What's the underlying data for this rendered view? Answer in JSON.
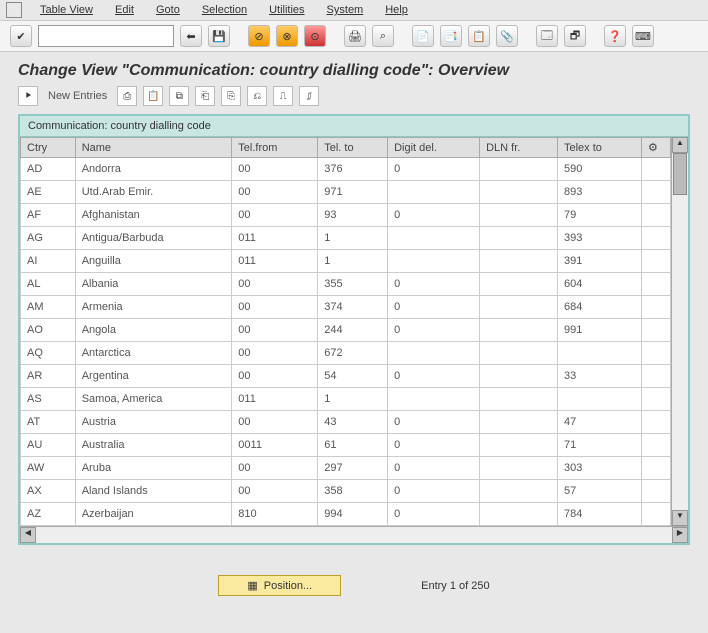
{
  "menu": {
    "items": [
      "Table View",
      "Edit",
      "Goto",
      "Selection",
      "Utilities",
      "System",
      "Help"
    ]
  },
  "toolbar": {
    "icons": [
      "✔",
      "⬅",
      "💾",
      "",
      "⊘",
      "⊗",
      "⊙",
      "",
      "🖨",
      "⌕",
      "",
      "📄",
      "📑",
      "📋",
      "📎",
      "",
      "🗔",
      "🗗",
      "",
      "❓",
      "⌨"
    ]
  },
  "title": "Change View \"Communication: country dialling code\": Overview",
  "appbar": {
    "new_entries": "New Entries",
    "icons": [
      "⎙",
      "📋",
      "⧉",
      "⎗",
      "⎘",
      "⎌",
      "⎍",
      "⎎"
    ]
  },
  "frame_title": "Communication: country dialling code",
  "cols": [
    "Ctry",
    "Name",
    "Tel.from",
    "Tel. to",
    "Digit del.",
    "DLN fr.",
    "Telex to"
  ],
  "rows": [
    {
      "c": "AD",
      "n": "Andorra",
      "tf": "00",
      "tt": "376",
      "dd": "0",
      "df": "",
      "tx": "590"
    },
    {
      "c": "AE",
      "n": "Utd.Arab Emir.",
      "tf": "00",
      "tt": "971",
      "dd": "",
      "df": "",
      "tx": "893"
    },
    {
      "c": "AF",
      "n": "Afghanistan",
      "tf": "00",
      "tt": "93",
      "dd": "0",
      "df": "",
      "tx": "79"
    },
    {
      "c": "AG",
      "n": "Antigua/Barbuda",
      "tf": "011",
      "tt": "1",
      "dd": "",
      "df": "",
      "tx": "393"
    },
    {
      "c": "AI",
      "n": "Anguilla",
      "tf": "011",
      "tt": "1",
      "dd": "",
      "df": "",
      "tx": "391"
    },
    {
      "c": "AL",
      "n": "Albania",
      "tf": "00",
      "tt": "355",
      "dd": "0",
      "df": "",
      "tx": "604"
    },
    {
      "c": "AM",
      "n": "Armenia",
      "tf": "00",
      "tt": "374",
      "dd": "0",
      "df": "",
      "tx": "684"
    },
    {
      "c": "AO",
      "n": "Angola",
      "tf": "00",
      "tt": "244",
      "dd": "0",
      "df": "",
      "tx": "991"
    },
    {
      "c": "AQ",
      "n": "Antarctica",
      "tf": "00",
      "tt": "672",
      "dd": "",
      "df": "",
      "tx": ""
    },
    {
      "c": "AR",
      "n": "Argentina",
      "tf": "00",
      "tt": "54",
      "dd": "0",
      "df": "",
      "tx": "33"
    },
    {
      "c": "AS",
      "n": "Samoa, America",
      "tf": "011",
      "tt": "1",
      "dd": "",
      "df": "",
      "tx": ""
    },
    {
      "c": "AT",
      "n": "Austria",
      "tf": "00",
      "tt": "43",
      "dd": "0",
      "df": "",
      "tx": "47"
    },
    {
      "c": "AU",
      "n": "Australia",
      "tf": "0011",
      "tt": "61",
      "dd": "0",
      "df": "",
      "tx": "71"
    },
    {
      "c": "AW",
      "n": "Aruba",
      "tf": "00",
      "tt": "297",
      "dd": "0",
      "df": "",
      "tx": "303"
    },
    {
      "c": "AX",
      "n": "Aland Islands",
      "tf": "00",
      "tt": "358",
      "dd": "0",
      "df": "",
      "tx": "57"
    },
    {
      "c": "AZ",
      "n": "Azerbaijan",
      "tf": "810",
      "tt": "994",
      "dd": "0",
      "df": "",
      "tx": "784"
    }
  ],
  "footer": {
    "position": "Position...",
    "entry": "Entry 1 of 250"
  }
}
